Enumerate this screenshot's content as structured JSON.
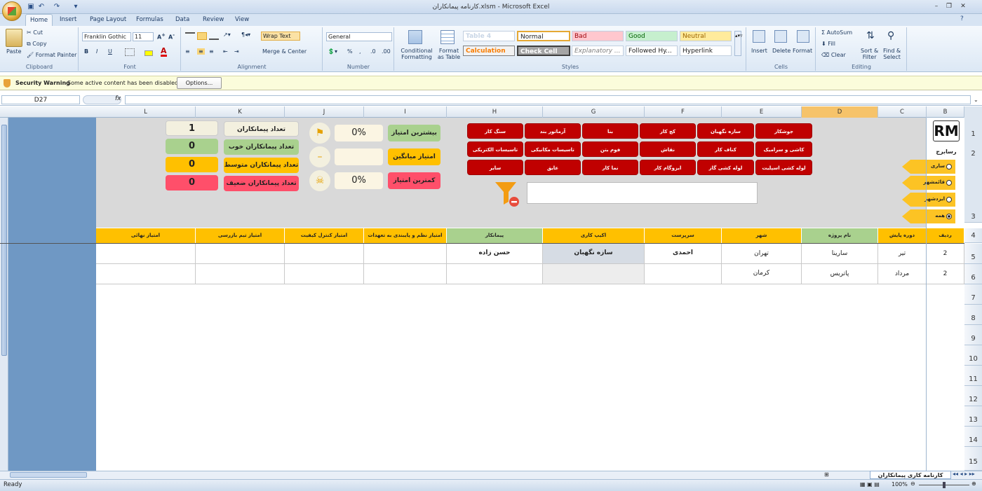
{
  "window": {
    "title": "کارنامه پیمانکاران.xlsm - Microsoft Excel"
  },
  "tabs": [
    "Home",
    "Insert",
    "Page Layout",
    "Formulas",
    "Data",
    "Review",
    "View"
  ],
  "ribbon": {
    "clipboard": {
      "paste": "Paste",
      "cut": "Cut",
      "copy": "Copy",
      "format_painter": "Format Painter",
      "label": "Clipboard"
    },
    "font": {
      "name": "Franklin Gothic",
      "size": "11",
      "label": "Font"
    },
    "alignment": {
      "wrap": "Wrap Text",
      "merge": "Merge & Center",
      "label": "Alignment"
    },
    "number": {
      "format": "General",
      "label": "Number"
    },
    "styles": {
      "conditional": "Conditional",
      "formatting": "Formatting",
      "format": "Format",
      "as_table": "as Table",
      "table4": "Table 4",
      "normal": "Normal",
      "bad": "Bad",
      "good": "Good",
      "neutral": "Neutral",
      "calculation": "Calculation",
      "check_cell": "Check Cell",
      "explanatory": "Explanatory ...",
      "followed": "Followed Hy...",
      "hyperlink": "Hyperlink",
      "label": "Styles"
    },
    "cells": {
      "insert": "Insert",
      "delete": "Delete",
      "format": "Format",
      "label": "Cells"
    },
    "editing": {
      "autosum": "AutoSum",
      "fill": "Fill",
      "clear": "Clear",
      "sort": "Sort &",
      "filter": "Filter",
      "find": "Find &",
      "select": "Select",
      "label": "Editing"
    }
  },
  "security": {
    "title": "Security Warning",
    "message": "Some active content has been disabled.",
    "options": "Options..."
  },
  "namebox": "D27",
  "fx": "fx",
  "columns": [
    "L",
    "K",
    "J",
    "I",
    "H",
    "G",
    "F",
    "E",
    "D",
    "C",
    "B"
  ],
  "rows": [
    "1",
    "2",
    "3",
    "4",
    "5",
    "6",
    "7",
    "8",
    "9",
    "10",
    "11",
    "12",
    "13",
    "14",
    "15"
  ],
  "dashboard": {
    "counts": [
      {
        "label": "تعداد پیمانکاران",
        "value": "1"
      },
      {
        "label": "تعداد پیمانکاران خوب",
        "value": "0"
      },
      {
        "label": "تعداد پیمانکاران متوسط",
        "value": "0"
      },
      {
        "label": "تعداد پیمانکاران ضعیف",
        "value": "0"
      }
    ],
    "scores": [
      {
        "label": "بیشترین امتیاز",
        "value": "0%"
      },
      {
        "label": "امتیاز میانگین",
        "value": ""
      },
      {
        "label": "کمترین امتیاز",
        "value": "0%"
      }
    ],
    "trades": [
      [
        "جوشکار",
        "سازه نگهبان",
        "کچ کار",
        "بنا",
        "آرماتور بند",
        "سنگ کار"
      ],
      [
        "کاشی و سرامیک",
        "کناف کار",
        "نقاش",
        "فوم بتن",
        "تاسیسات مکانیکی",
        "تاسیسات الکتریکی"
      ],
      [
        "لوله کشی اسپلیت",
        "لوله کشی گاز",
        "ایزوگام کار",
        "نما کار",
        "عایق",
        "سایر"
      ]
    ],
    "project_options": [
      "ساری",
      "قائمشهر",
      "ایزدشهر",
      "همه"
    ],
    "selected_option": "همه",
    "logo_text": "رسابرج"
  },
  "header": [
    "امتیاز نهائی",
    "امتیاز تیم بازرسی",
    "امتیاز کنترل کیفیت",
    "امتیاز نظم و پایبندی به تعهدات",
    "پیمانکار",
    "اکیپ کاری",
    "سرپرست",
    "شهر",
    "نام پروژه",
    "دوره پایش",
    "ردیف"
  ],
  "table": [
    {
      "row": "2",
      "period": "تیر",
      "project": "سارینا",
      "city": "تهران",
      "supervisor": "احمدی",
      "team": "سازه نگهبان",
      "contractor": "حسن زاده"
    },
    {
      "row": "2",
      "period": "مرداد",
      "project": "پاتریس",
      "city": "کرمان",
      "supervisor": "",
      "team": "",
      "contractor": ""
    }
  ],
  "sheet_tab": "کارنامه کاری پیمانکاران",
  "status": {
    "ready": "Ready",
    "zoom": "100%"
  }
}
